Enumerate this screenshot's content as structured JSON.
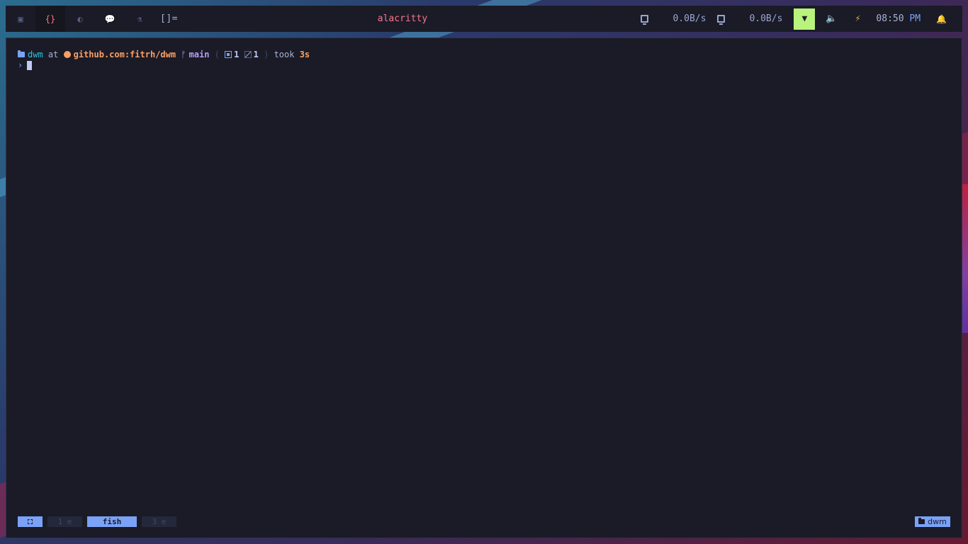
{
  "bar": {
    "tags": [
      {
        "icon": "terminal-icon",
        "glyph": "▣",
        "active": false
      },
      {
        "icon": "code-icon",
        "glyph": "{}",
        "active": true
      },
      {
        "icon": "browser-icon",
        "glyph": "◐",
        "active": false
      },
      {
        "icon": "chat-icon",
        "glyph": "💬",
        "active": false
      },
      {
        "icon": "flask-icon",
        "glyph": "⚗",
        "active": false
      }
    ],
    "layout": "[]=",
    "title": "alacritty",
    "download_speed": "0.0B/s",
    "upload_speed": "0.0B/s",
    "time": "08:50",
    "ampm": "PM",
    "colors": {
      "wifi_bg": "#b9f27c",
      "title": "#f7768e"
    }
  },
  "terminal": {
    "dir": "dwm",
    "at": "at",
    "repo": "github.com:fitrh/dwm",
    "branch": "main",
    "paren_open": "(",
    "staged_count": "1",
    "modified_count": "1",
    "paren_close": ")",
    "took": "took",
    "duration": "3s",
    "prompt": "›"
  },
  "tmux": {
    "win1": "1 e",
    "win2": "fish",
    "win3": "3 e",
    "session": "dwm"
  }
}
